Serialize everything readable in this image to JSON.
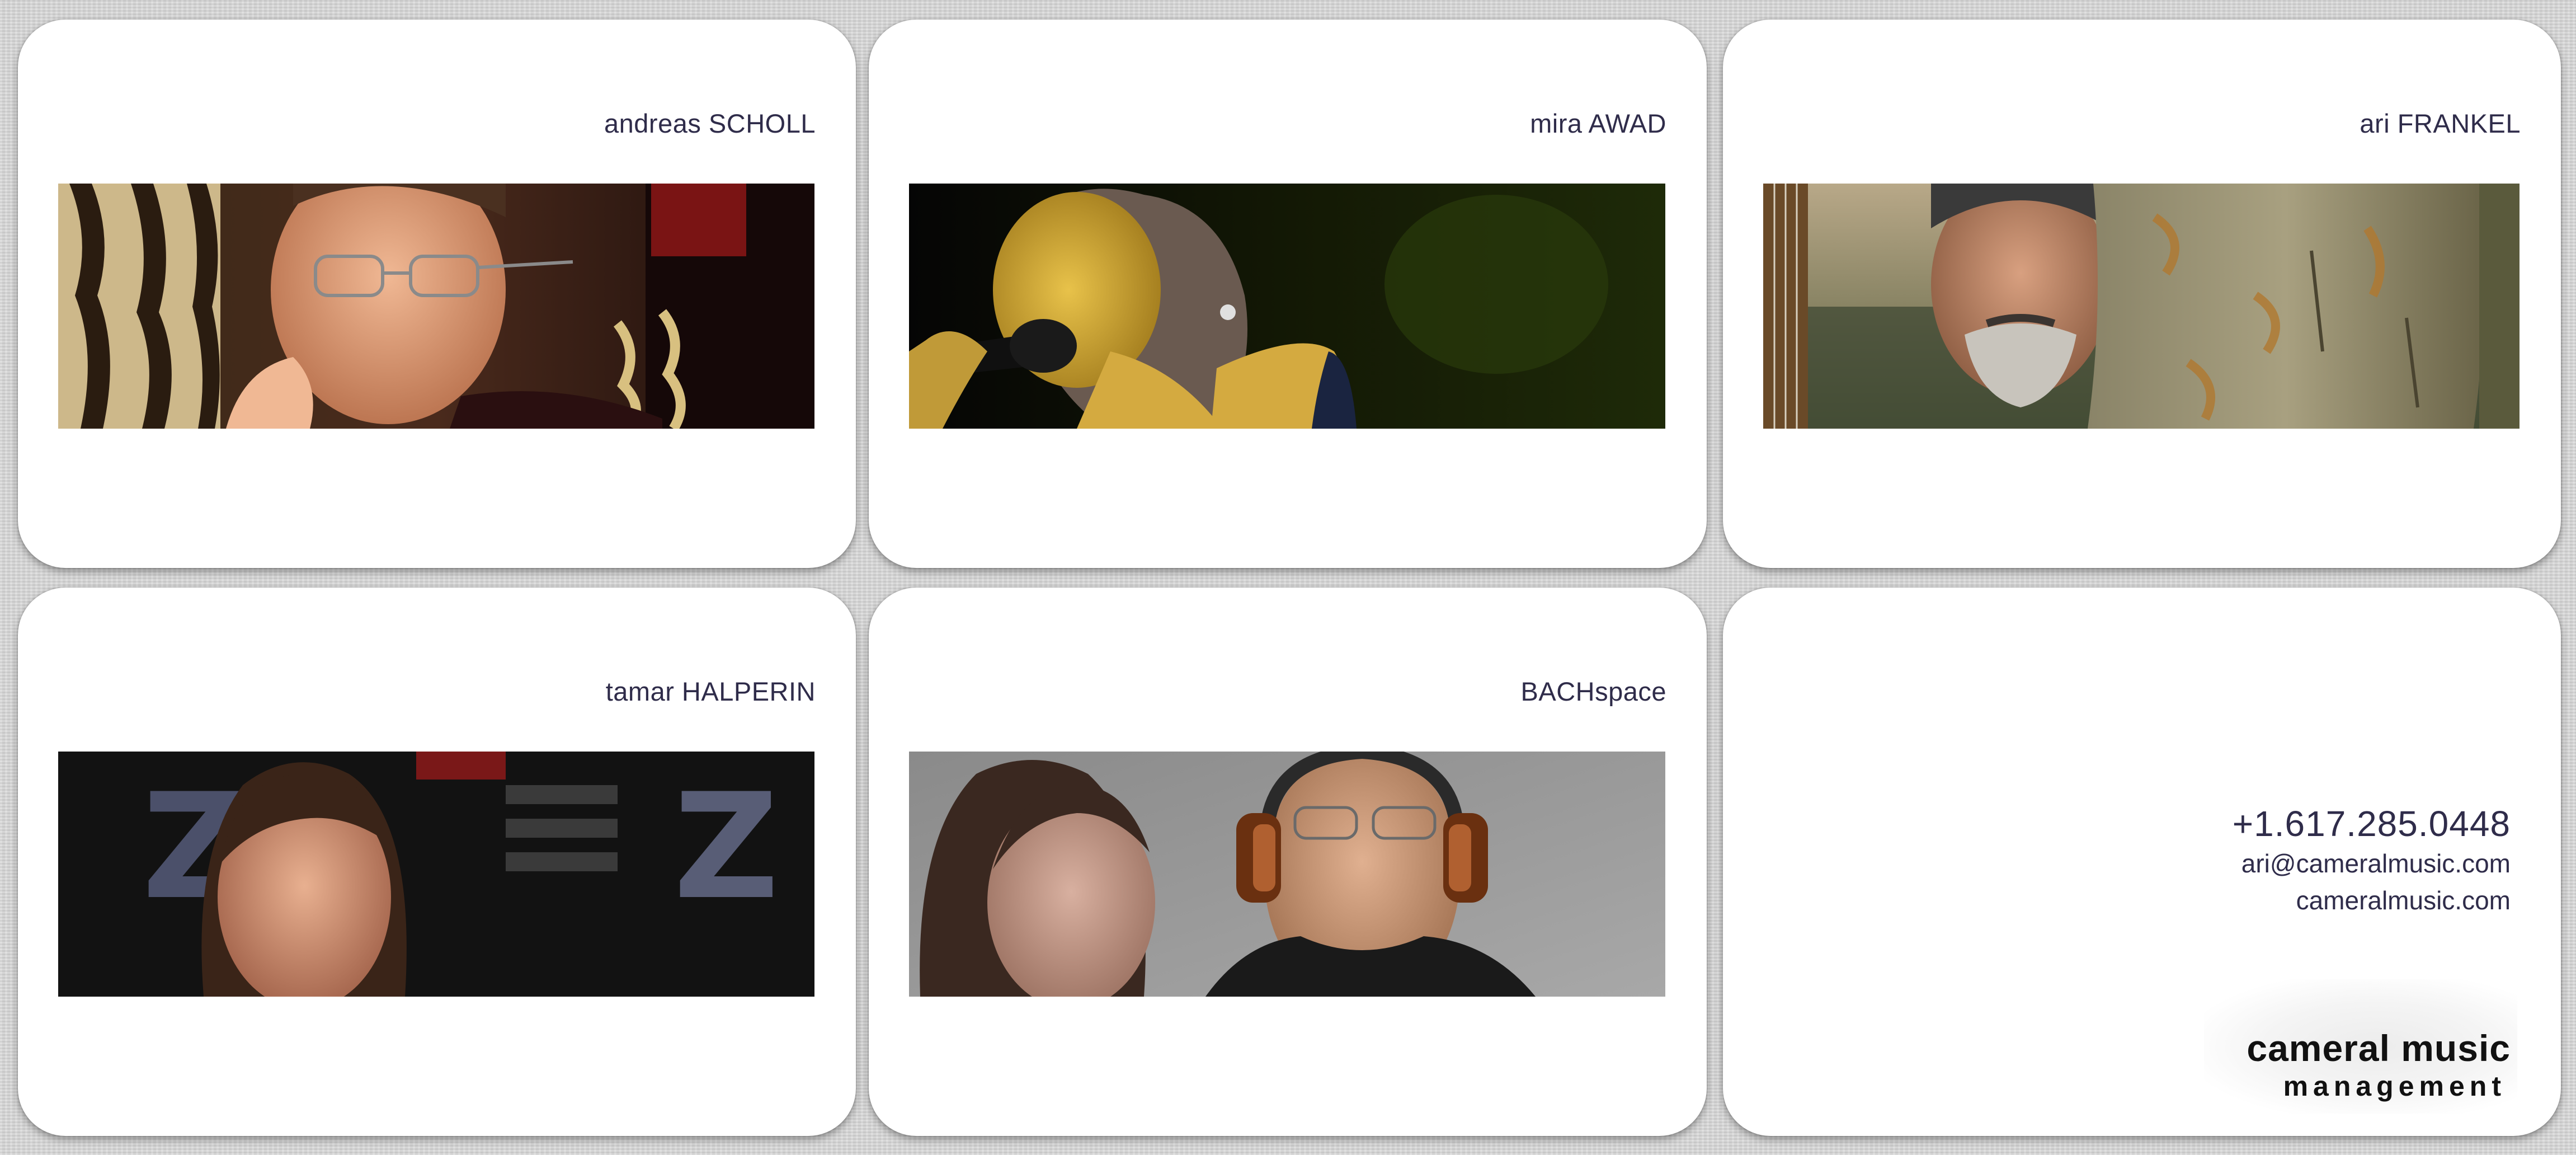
{
  "cards": [
    {
      "name": "andreas SCHOLL",
      "photo_icon": "portrait-photo"
    },
    {
      "name": "mira AWAD",
      "photo_icon": "portrait-photo"
    },
    {
      "name": "ari FRANKEL",
      "photo_icon": "portrait-photo"
    },
    {
      "name": "tamar HALPERIN",
      "photo_icon": "portrait-photo"
    },
    {
      "name": "BACHspace",
      "photo_icon": "portrait-photo"
    }
  ],
  "contact": {
    "phone": "+1.617.285.0448",
    "email": "ari@cameralmusic.com",
    "website": "cameralmusic.com"
  },
  "logo": {
    "line1": "cameral music",
    "line2": "management"
  },
  "colors": {
    "background": "#d4d4d4",
    "card": "#ffffff",
    "text": "#2f2c4a",
    "logo_text": "#111111"
  }
}
